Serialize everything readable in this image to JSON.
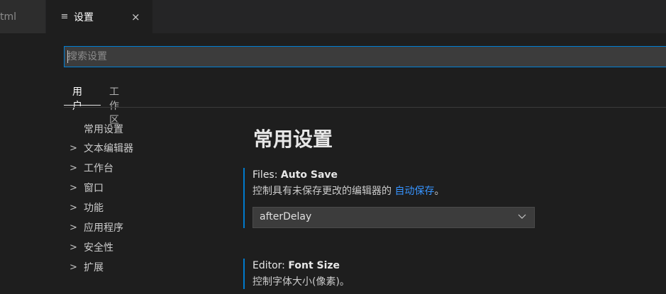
{
  "tabs": [
    {
      "label": "tml",
      "active": false
    },
    {
      "label": "设置",
      "active": true,
      "icon": "settings-file-icon",
      "close_glyph": "×"
    }
  ],
  "search": {
    "placeholder": "搜索设置"
  },
  "scope_tabs": [
    {
      "label": "用户",
      "active": true
    },
    {
      "label": "工作区",
      "active": false
    }
  ],
  "toc": [
    {
      "label": "常用设置",
      "expandable": false
    },
    {
      "label": "文本编辑器",
      "expandable": true
    },
    {
      "label": "工作台",
      "expandable": true
    },
    {
      "label": "窗口",
      "expandable": true
    },
    {
      "label": "功能",
      "expandable": true
    },
    {
      "label": "应用程序",
      "expandable": true
    },
    {
      "label": "安全性",
      "expandable": true
    },
    {
      "label": "扩展",
      "expandable": true
    }
  ],
  "toc_chevron": ">",
  "section_title": "常用设置",
  "settings": [
    {
      "category": "Files: ",
      "name": "Auto Save",
      "desc_prefix": "控制具有未保存更改的编辑器的 ",
      "desc_link": "自动保存",
      "desc_suffix": "。",
      "control": {
        "type": "select",
        "value": "afterDelay"
      }
    },
    {
      "category": "Editor: ",
      "name": "Font Size",
      "desc_prefix": "控制字体大小(像素)。",
      "desc_link": "",
      "desc_suffix": ""
    }
  ],
  "colors": {
    "accent": "#007acc",
    "focus_border": "#007fd4",
    "link": "#3794ff",
    "background": "#1e1e1e"
  }
}
